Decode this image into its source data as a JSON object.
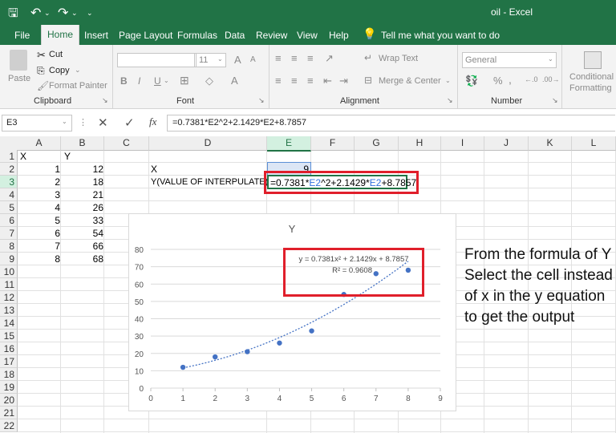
{
  "quick_access": {
    "save_icon": "save-icon",
    "undo_icon": "undo-icon",
    "redo_icon": "redo-icon"
  },
  "window": {
    "title": "oil  -  Excel"
  },
  "tabs": [
    "File",
    "Home",
    "Insert",
    "Page Layout",
    "Formulas",
    "Data",
    "Review",
    "View",
    "Help"
  ],
  "tell_me": "Tell me what you want to do",
  "ribbon": {
    "clipboard": {
      "paste": "Paste",
      "cut": "Cut",
      "copy": "Copy",
      "format_painter": "Format Painter",
      "label": "Clipboard"
    },
    "font": {
      "font_size": "11",
      "bold": "B",
      "italic": "I",
      "underline": "U",
      "grow": "A",
      "shrink": "A",
      "label": "Font"
    },
    "alignment": {
      "wrap_text": "Wrap Text",
      "merge_center": "Merge & Center",
      "label": "Alignment"
    },
    "number": {
      "format": "General",
      "percent": "%",
      "comma": ",",
      "label": "Number"
    },
    "styles": {
      "conditional_1": "Conditional",
      "conditional_2": "Formatting"
    }
  },
  "formula_bar": {
    "name_box": "E3",
    "fx": "fx",
    "formula": "=0.7381*E2^2+2.1429*E2+8.7857"
  },
  "columns": [
    "A",
    "B",
    "C",
    "D",
    "E",
    "F",
    "G",
    "H",
    "I",
    "J",
    "K",
    "L"
  ],
  "rows": [
    "1",
    "2",
    "3",
    "4",
    "5",
    "6",
    "7",
    "8",
    "9",
    "10",
    "11",
    "12",
    "13",
    "14",
    "15",
    "16",
    "17",
    "18",
    "19",
    "20",
    "21",
    "22"
  ],
  "cells": {
    "A1": "X",
    "B1": "Y",
    "A2": "1",
    "B2": "12",
    "A3": "2",
    "B3": "18",
    "A4": "3",
    "B4": "21",
    "A5": "4",
    "B5": "26",
    "A6": "5",
    "B6": "33",
    "A7": "6",
    "B7": "54",
    "A8": "7",
    "B8": "66",
    "A9": "8",
    "B9": "68",
    "D2": "X",
    "E2": "9",
    "D3": "Y(VALUE OF INTERPULATE)",
    "E3_edit": [
      "=0.7381*",
      "E2",
      "^2+2.1429*",
      "E2",
      "+8.7857"
    ]
  },
  "chart_data": {
    "type": "scatter",
    "title": "Y",
    "x": [
      1,
      2,
      3,
      4,
      5,
      6,
      7,
      8
    ],
    "y": [
      12,
      18,
      21,
      26,
      33,
      54,
      66,
      68
    ],
    "xlim": [
      0,
      9
    ],
    "ylim": [
      0,
      80
    ],
    "xticks": [
      "0",
      "1",
      "2",
      "3",
      "4",
      "5",
      "6",
      "7",
      "8",
      "9"
    ],
    "yticks": [
      "0",
      "10",
      "20",
      "30",
      "40",
      "50",
      "60",
      "70",
      "80"
    ],
    "trendline": {
      "type": "polynomial",
      "order": 2,
      "coefficients": [
        0.7381,
        2.1429,
        8.7857
      ],
      "equation": "y = 0.7381x² + 2.1429x + 8.7857",
      "r2": "R² = 0.9608"
    },
    "grid": true,
    "marker_color": "#4472c4"
  },
  "annotation": "From the formula of Y Select the cell instead of x in the y equation to get the output",
  "colors": {
    "excel_green": "#217346",
    "highlight_red": "#e01f2b",
    "reference_blue": "#2f6fde"
  }
}
